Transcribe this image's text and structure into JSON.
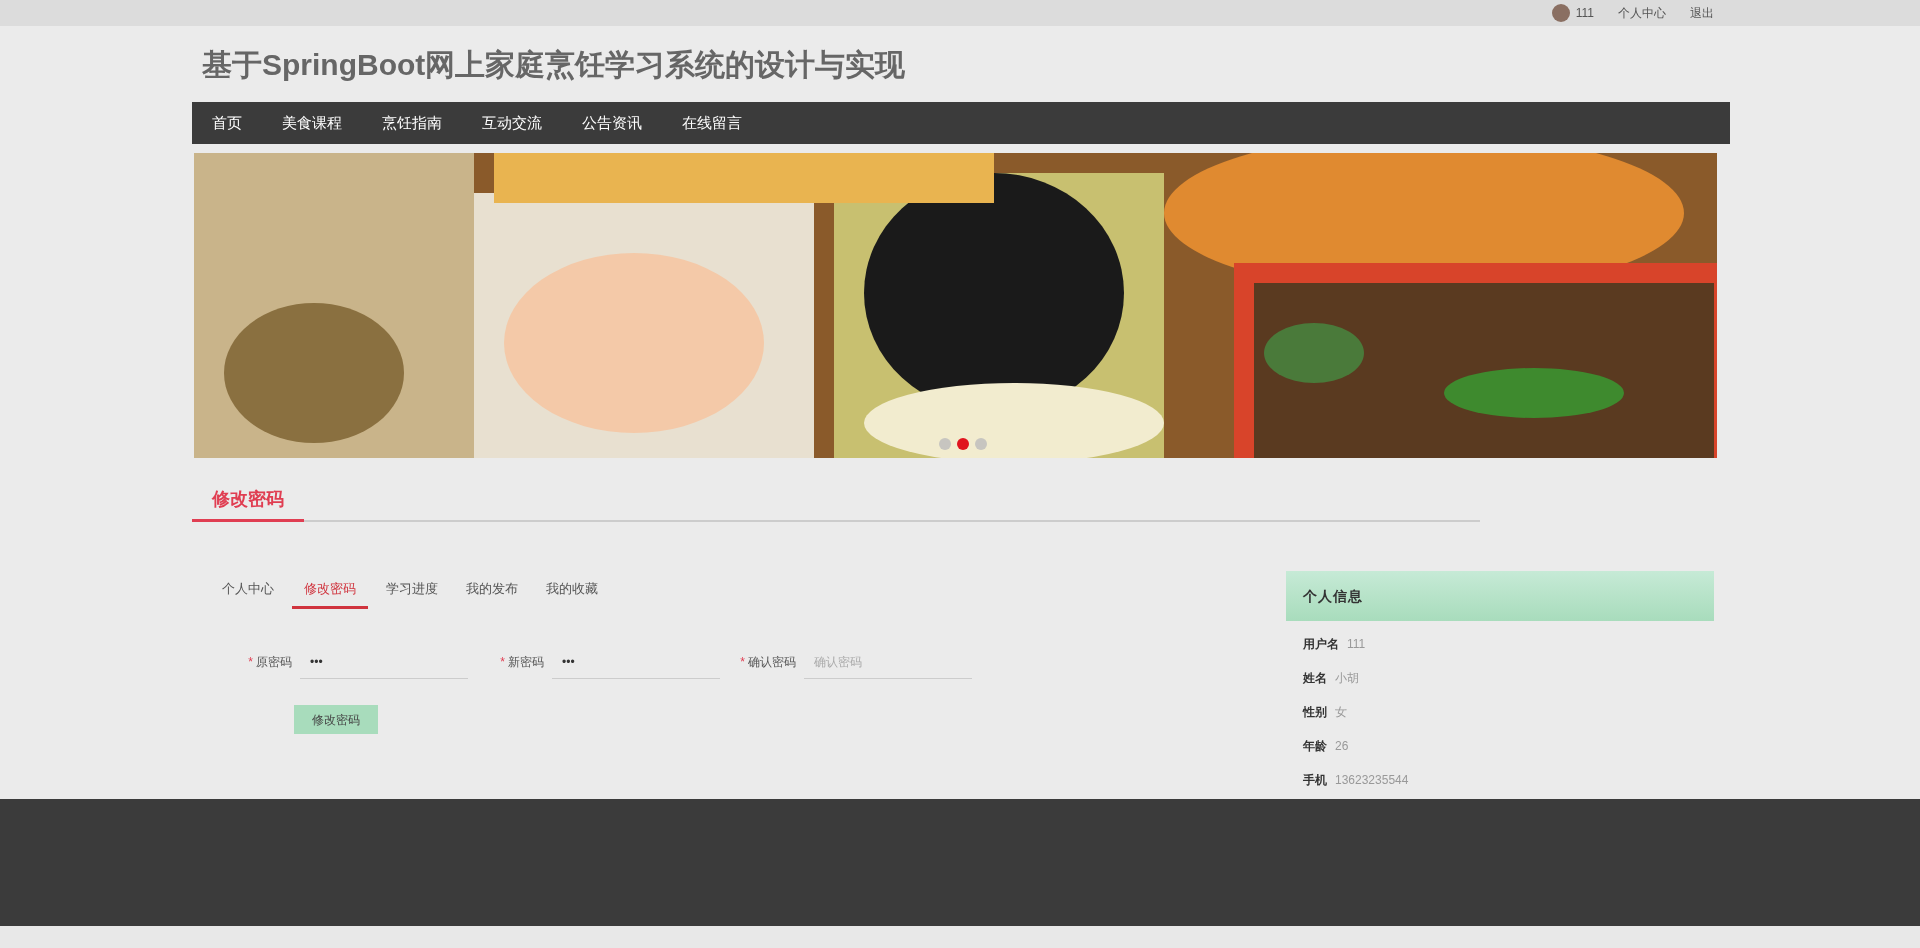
{
  "top_bar": {
    "username": "111",
    "links": [
      "个人中心",
      "退出"
    ]
  },
  "site_title": "基于SpringBoot网上家庭烹饪学习系统的设计与实现",
  "nav": [
    "首页",
    "美食课程",
    "烹饪指南",
    "互动交流",
    "公告资讯",
    "在线留言"
  ],
  "banner": {
    "dots": [
      {
        "selected": false
      },
      {
        "selected": true
      },
      {
        "selected": false
      }
    ]
  },
  "section_title": "修改密码",
  "tabs": [
    {
      "label": "个人中心",
      "selected": false
    },
    {
      "label": "修改密码",
      "selected": true
    },
    {
      "label": "学习进度",
      "selected": false
    },
    {
      "label": "我的发布",
      "selected": false
    },
    {
      "label": "我的收藏",
      "selected": false
    }
  ],
  "form": {
    "fields": [
      {
        "required_mark": "*",
        "label": "原密码",
        "value": "•••"
      },
      {
        "required_mark": "*",
        "label": "新密码",
        "value": "•••"
      },
      {
        "required_mark": "*",
        "label": "确认密码",
        "placeholder": "确认密码"
      }
    ],
    "submit": "修改密码"
  },
  "profile": {
    "title": "个人信息",
    "rows": [
      {
        "label": "用户名",
        "value": "111"
      },
      {
        "label": "姓名",
        "value": "小胡"
      },
      {
        "label": "性别",
        "value": "女"
      },
      {
        "label": "年龄",
        "value": "26"
      },
      {
        "label": "手机",
        "value": "13623235544"
      }
    ]
  }
}
